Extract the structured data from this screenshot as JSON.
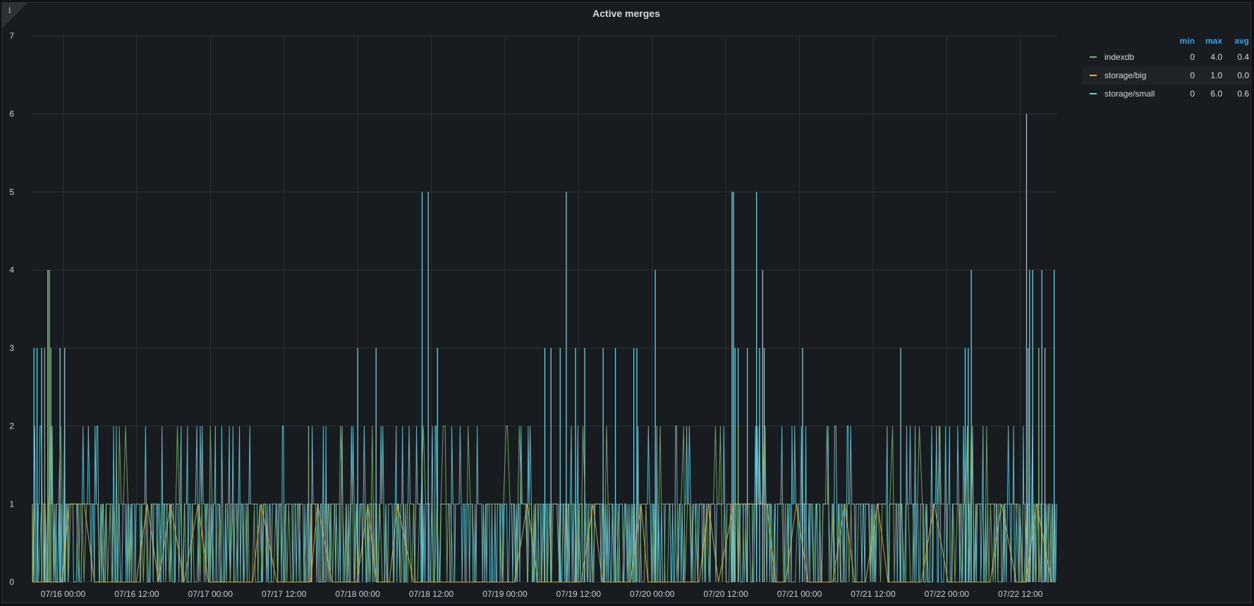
{
  "panel": {
    "title": "Active merges",
    "info_icon": "info-icon"
  },
  "legend": {
    "headers": {
      "min": "min",
      "max": "max",
      "avg": "avg"
    },
    "rows": [
      {
        "name": "indexdb",
        "color": "#7eb26d",
        "min": "0",
        "max": "4.0",
        "avg": "0.4"
      },
      {
        "name": "storage/big",
        "color": "#eab839",
        "min": "0",
        "max": "1.0",
        "avg": "0.0"
      },
      {
        "name": "storage/small",
        "color": "#6ed0e0",
        "min": "0",
        "max": "6.0",
        "avg": "0.6"
      }
    ]
  },
  "chart_data": {
    "type": "line",
    "title": "Active merges",
    "xlabel": "",
    "ylabel": "",
    "x_range": [
      "07/15 19:00",
      "07/22 18:00"
    ],
    "ylim": [
      0,
      7
    ],
    "yticks": [
      "0",
      "1",
      "2",
      "3",
      "4",
      "5",
      "6",
      "7"
    ],
    "xticks": [
      "07/16 00:00",
      "07/16 12:00",
      "07/17 00:00",
      "07/17 12:00",
      "07/18 00:00",
      "07/18 12:00",
      "07/19 00:00",
      "07/19 12:00",
      "07/20 00:00",
      "07/20 12:00",
      "07/21 00:00",
      "07/21 12:00",
      "07/22 00:00",
      "07/22 12:00"
    ],
    "grid": true,
    "legend_position": "right",
    "series": [
      {
        "name": "indexdb",
        "color": "#7eb26d",
        "min": 0,
        "max": 4,
        "avg": 0.4,
        "peaks": [
          [
            "07/15 21:30",
            4
          ],
          [
            "07/15 21:45",
            4
          ],
          [
            "07/15 21:00",
            3
          ],
          [
            "07/15 22:00",
            3
          ],
          [
            "07/17 16:00",
            2
          ],
          [
            "07/20 14:00",
            2
          ],
          [
            "07/22 15:00",
            3
          ]
        ]
      },
      {
        "name": "storage/big",
        "color": "#eab839",
        "min": 0,
        "max": 1,
        "avg": 0.0,
        "peaks": [
          [
            "07/15 21:00",
            1
          ],
          [
            "07/17 16:30",
            1
          ],
          [
            "07/20 13:00",
            1
          ]
        ]
      },
      {
        "name": "storage/small",
        "color": "#6ed0e0",
        "min": 0,
        "max": 6,
        "avg": 0.6,
        "peaks": [
          [
            "07/15 19:15",
            3
          ],
          [
            "07/15 19:45",
            3
          ],
          [
            "07/15 20:30",
            3
          ],
          [
            "07/15 21:30",
            4
          ],
          [
            "07/15 21:45",
            4
          ],
          [
            "07/15 22:00",
            3
          ],
          [
            "07/15 23:30",
            3
          ],
          [
            "07/16 00:15",
            3
          ],
          [
            "07/18 00:00",
            3
          ],
          [
            "07/18 03:00",
            3
          ],
          [
            "07/18 10:30",
            5
          ],
          [
            "07/18 11:30",
            5
          ],
          [
            "07/18 13:00",
            3
          ],
          [
            "07/19 06:30",
            3
          ],
          [
            "07/19 07:30",
            3
          ],
          [
            "07/19 09:00",
            3
          ],
          [
            "07/19 10:00",
            5
          ],
          [
            "07/19 11:30",
            3
          ],
          [
            "07/19 13:00",
            3
          ],
          [
            "07/19 16:00",
            3
          ],
          [
            "07/19 18:00",
            3
          ],
          [
            "07/19 21:00",
            3
          ],
          [
            "07/19 21:30",
            3
          ],
          [
            "07/20 00:30",
            4
          ],
          [
            "07/20 13:00",
            5
          ],
          [
            "07/20 13:15",
            5
          ],
          [
            "07/20 13:30",
            3
          ],
          [
            "07/20 14:00",
            3
          ],
          [
            "07/20 15:30",
            3
          ],
          [
            "07/20 17:00",
            5
          ],
          [
            "07/20 17:30",
            3
          ],
          [
            "07/20 18:00",
            4
          ],
          [
            "07/20 18:15",
            3
          ],
          [
            "07/21 00:30",
            3
          ],
          [
            "07/21 16:30",
            3
          ],
          [
            "07/22 03:00",
            3
          ],
          [
            "07/22 03:30",
            3
          ],
          [
            "07/22 04:00",
            4
          ],
          [
            "07/22 13:00",
            6
          ],
          [
            "07/22 13:15",
            3
          ],
          [
            "07/22 13:30",
            4
          ],
          [
            "07/22 14:00",
            4
          ],
          [
            "07/22 15:00",
            3
          ],
          [
            "07/22 15:30",
            4
          ],
          [
            "07/22 16:00",
            3
          ],
          [
            "07/22 17:30",
            4
          ]
        ]
      }
    ]
  }
}
